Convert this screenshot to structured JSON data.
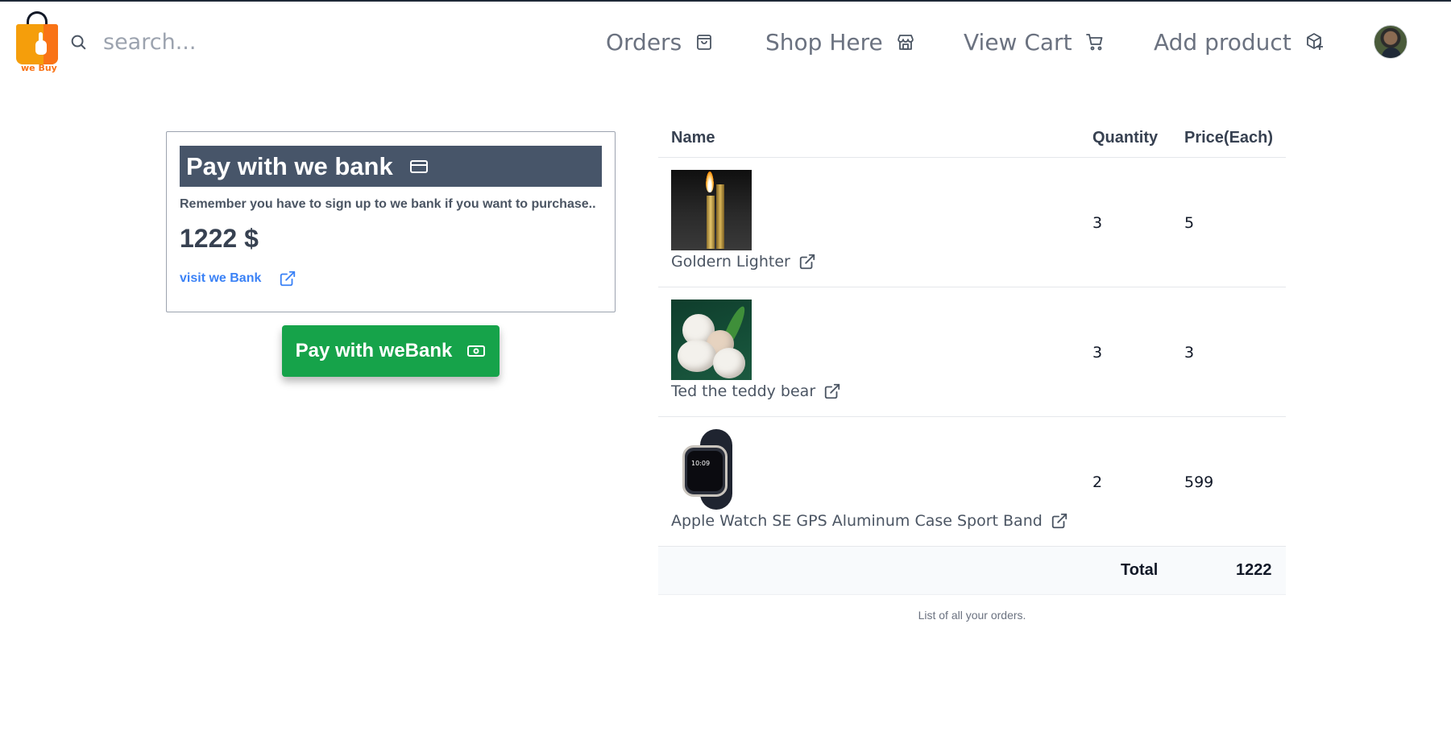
{
  "brand": {
    "logo_text": "we Buy",
    "accent_color": "#f59e0b",
    "accent_dark": "#f97316"
  },
  "search": {
    "placeholder": "search..."
  },
  "nav": {
    "orders": {
      "label": "Orders",
      "icon": "shopping-bag-icon"
    },
    "shop": {
      "label": "Shop Here",
      "icon": "store-icon"
    },
    "cart": {
      "label": "View Cart",
      "icon": "shopping-cart-icon"
    },
    "add_product": {
      "label": "Add product",
      "icon": "package-plus-icon"
    },
    "avatar": {
      "icon": "user-avatar"
    }
  },
  "payment_card": {
    "title": "Pay with we bank",
    "title_icon": "credit-card-icon",
    "note": "Remember you have to sign up to we bank if you want to purchase..",
    "amount": "1222 $",
    "link_label": "visit we Bank",
    "link_icon": "external-link-icon",
    "header_color": "#475569",
    "link_color": "#3b82f6"
  },
  "pay_button": {
    "label": "Pay with weBank",
    "icon": "banknote-icon",
    "color": "#16a34a"
  },
  "orders_table": {
    "headers": {
      "name": "Name",
      "quantity": "Quantity",
      "price": "Price(Each)"
    },
    "rows": [
      {
        "name": "Goldern Lighter",
        "quantity": "3",
        "price": "5",
        "image": "lighter-image"
      },
      {
        "name": "Ted the teddy bear",
        "quantity": "3",
        "price": "3",
        "image": "teddy-bear-image"
      },
      {
        "name": "Apple Watch SE GPS Aluminum Case Sport Band",
        "quantity": "2",
        "price": "599",
        "image": "apple-watch-image",
        "watch_time": "10:09"
      }
    ],
    "total_label": "Total",
    "total_value": "1222",
    "caption": "List of all your orders."
  }
}
